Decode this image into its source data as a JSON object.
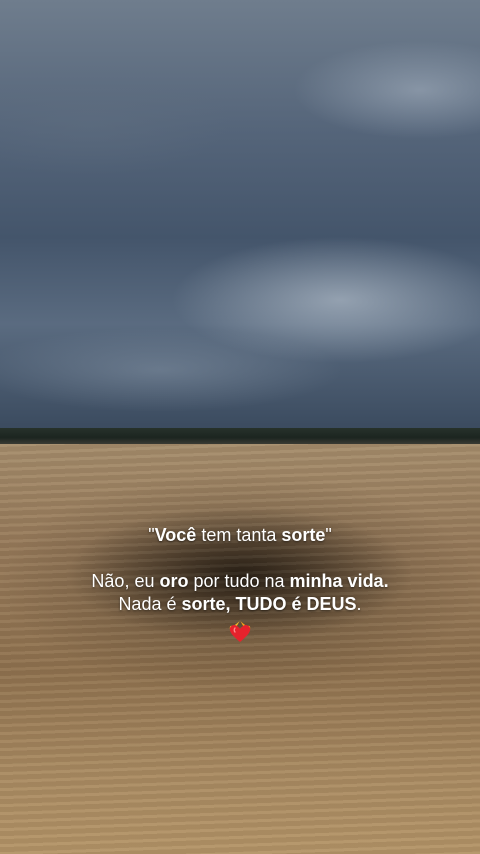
{
  "quote": {
    "open_quote": "\"",
    "w1": "Você",
    "w2": " tem tanta ",
    "w3": "sorte",
    "close_quote": "\""
  },
  "line2": {
    "a": "Não, eu ",
    "b": "oro",
    "c": " por tudo na ",
    "d": "minha vida."
  },
  "line3": {
    "a": "Nada é ",
    "b": "sorte, TUDO é DEUS",
    "c": "."
  },
  "emoji": {
    "icon": "heart-on-fire-icon"
  }
}
